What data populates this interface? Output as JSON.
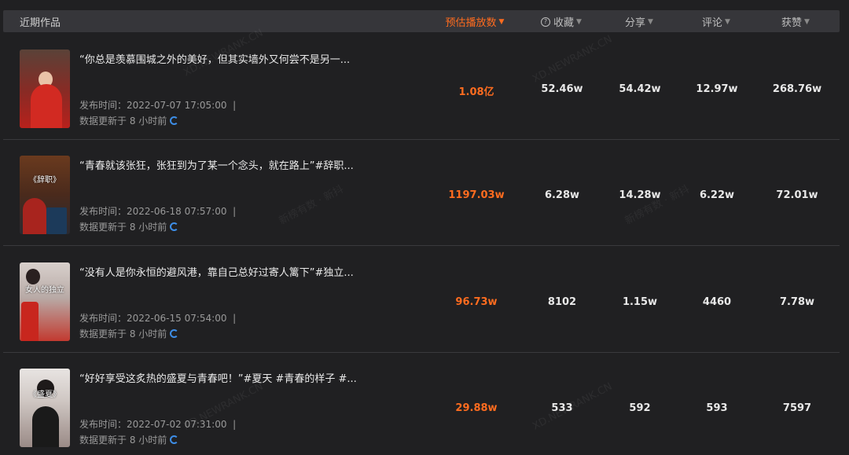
{
  "header": {
    "title": "近期作品",
    "columns": [
      {
        "label": "预估播放数",
        "active": true,
        "has_help": false
      },
      {
        "label": "收藏",
        "active": false,
        "has_help": true
      },
      {
        "label": "分享",
        "active": false,
        "has_help": false
      },
      {
        "label": "评论",
        "active": false,
        "has_help": false
      },
      {
        "label": "获赞",
        "active": false,
        "has_help": false
      }
    ],
    "help_icon": "question-circle-icon",
    "sort_icon": "caret-down-icon"
  },
  "colors": {
    "accent": "#ff6c1f",
    "background": "#202022",
    "header_bg": "#36363a",
    "refresh": "#3d8ee8"
  },
  "rows": [
    {
      "title": "“你总是羡慕围城之外的美好，但其实墙外又何尝不是另一...",
      "publish_label": "发布时间：",
      "publish_time": "2022-07-07 17:05:00",
      "update_text": "数据更新于 8 小时前",
      "thumb_text": "",
      "plays": "1.08亿",
      "favorites": "52.46w",
      "shares": "54.42w",
      "comments": "12.97w",
      "likes": "268.76w"
    },
    {
      "title": "“青春就该张狂，张狂到为了某一个念头，就在路上”#辞职...",
      "publish_label": "发布时间：",
      "publish_time": "2022-06-18 07:57:00",
      "update_text": "数据更新于 8 小时前",
      "thumb_text": "《辞职》",
      "plays": "1197.03w",
      "favorites": "6.28w",
      "shares": "14.28w",
      "comments": "6.22w",
      "likes": "72.01w"
    },
    {
      "title": "“没有人是你永恒的避风港，靠自己总好过寄人篱下”#独立...",
      "publish_label": "发布时间：",
      "publish_time": "2022-06-15 07:54:00",
      "update_text": "数据更新于 8 小时前",
      "thumb_text": "女人的独立",
      "plays": "96.73w",
      "favorites": "8102",
      "shares": "1.15w",
      "comments": "4460",
      "likes": "7.78w"
    },
    {
      "title": "“好好享受这炙热的盛夏与青春吧！”#夏天 #青春的样子 #...",
      "publish_label": "发布时间：",
      "publish_time": "2022-07-02 07:31:00",
      "update_text": "数据更新于 8 小时前",
      "thumb_text": "《盛夏》",
      "plays": "29.88w",
      "favorites": "533",
      "shares": "592",
      "comments": "593",
      "likes": "7597"
    }
  ],
  "watermarks": [
    "XD.NEWRANK.CN",
    "新榜有数 · 新抖"
  ]
}
